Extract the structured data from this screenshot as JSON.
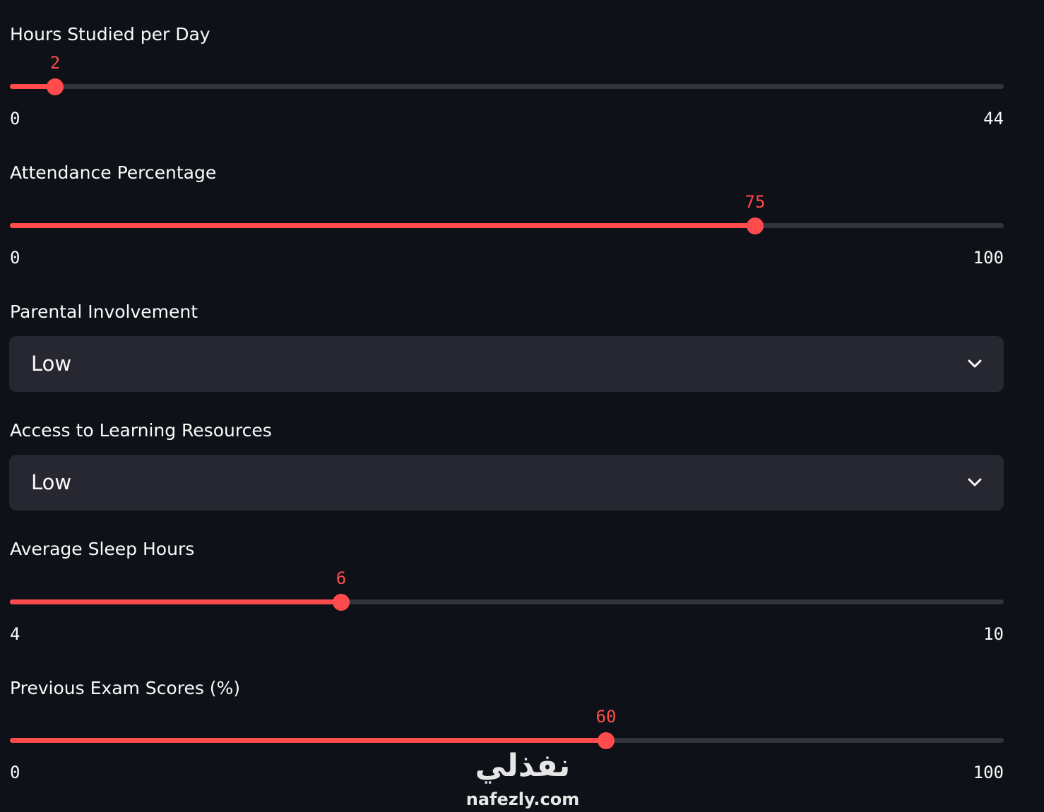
{
  "sliders": [
    {
      "label": "Hours Studied per Day",
      "value": "2",
      "min": "0",
      "max": "44",
      "fraction": 0.0455
    },
    {
      "label": "Attendance Percentage",
      "value": "75",
      "min": "0",
      "max": "100",
      "fraction": 0.75
    },
    {
      "label": "Average Sleep Hours",
      "value": "6",
      "min": "4",
      "max": "10",
      "fraction": 0.3333
    },
    {
      "label": "Previous Exam Scores (%)",
      "value": "60",
      "min": "0",
      "max": "100",
      "fraction": 0.6
    }
  ],
  "selects": [
    {
      "label": "Parental Involvement",
      "value": "Low"
    },
    {
      "label": "Access to Learning Resources",
      "value": "Low"
    }
  ],
  "watermark": {
    "arabic": "نفذلي",
    "latin": "nafezly.com"
  },
  "colors": {
    "background": "#0e1117",
    "accent": "#ff4b4b",
    "track": "#32343d",
    "select_bg": "#262730",
    "text": "#fafafa"
  },
  "icons": {
    "select_arrow": "chevron-down-icon"
  }
}
